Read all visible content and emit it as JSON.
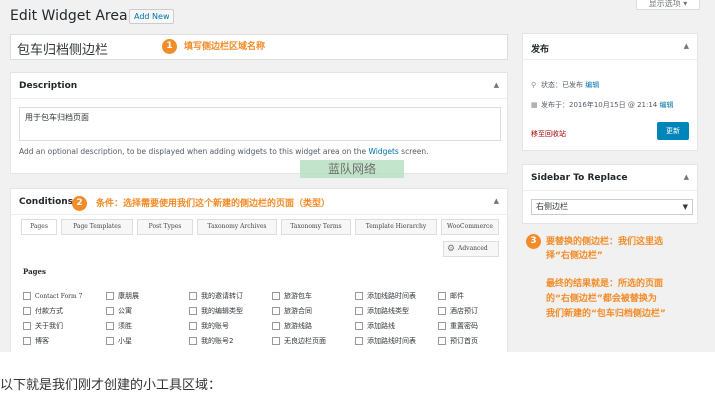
{
  "header": {
    "title": "Edit Widget Area",
    "add_new": "Add New",
    "screen_options": "显示选项 ▾"
  },
  "name_field": {
    "value": "包车归档侧边栏"
  },
  "annotations": {
    "a1": {
      "num": "1",
      "text": "填写侧边栏区域名称"
    },
    "a2": {
      "num": "2",
      "text": "条件：选择需要使用我们这个新建的侧边栏的页面（类型）"
    },
    "a3": {
      "num": "3",
      "line1": "要替换的侧边栏：我们这里选",
      "line2": "择“右侧边栏”"
    },
    "a4": {
      "line1": "最终的结果就是：所选的页面",
      "line2": "的“右侧边栏”都会被替换为",
      "line3": "我们新建的“包车归档侧边栏”"
    }
  },
  "description": {
    "title": "Description",
    "value": "用于包车归档页面",
    "help_before": "Add an optional description, to be displayed when adding widgets to this widget area on the ",
    "help_link": "Widgets",
    "help_after": " screen."
  },
  "watermark": "蓝队网络",
  "conditions": {
    "title": "Conditions",
    "tabs": [
      "Pages",
      "Page Templates",
      "Post Types",
      "Taxonomy Archives",
      "Taxonomy Terms",
      "Template Hierarchy",
      "WooCommerce"
    ],
    "advanced": "Advanced",
    "pages_heading": "Pages",
    "columns": [
      [
        "Contact Form 7",
        "付款方式",
        "关于我们",
        "博客"
      ],
      [
        "康朋展",
        "公寓",
        "须胜",
        "小星"
      ],
      [
        "我的邀请转订",
        "我的编辑类型",
        "我的账号",
        "我的账号2"
      ],
      [
        "旅游包车",
        "旅游合同",
        "旅游线路",
        "无良边栏页面"
      ],
      [
        "添加线路时间表",
        "添加路线类型",
        "添加路线",
        "添加路线时间表"
      ],
      [
        "邮件",
        "酒店预订",
        "重置密码",
        "预订首页"
      ]
    ]
  },
  "publish": {
    "title": "发布",
    "status_label": "状态：",
    "status_value": "已发布",
    "status_edit": "编辑",
    "date_label": "发布于：",
    "date_value": "2016年10月15日 @ 21:14",
    "date_edit": "编辑",
    "trash": "移至回收站",
    "update": "更新"
  },
  "sidebar_replace": {
    "title": "Sidebar To Replace",
    "selected": "右侧边栏"
  },
  "footer_caption": "以下就是我们刚才创建的小工具区域："
}
